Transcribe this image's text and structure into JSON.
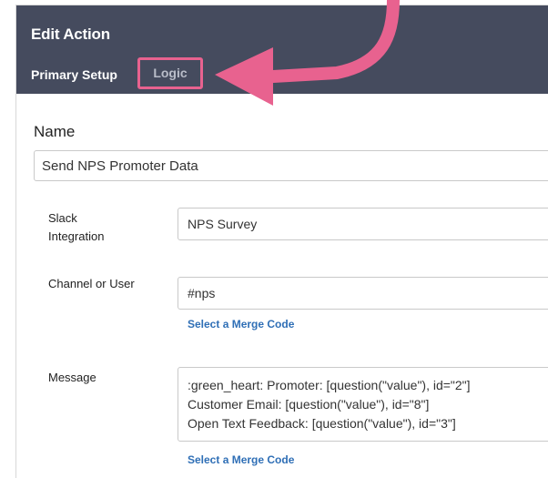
{
  "header": {
    "title": "Edit Action",
    "tabs": {
      "primary": "Primary Setup",
      "logic": "Logic"
    }
  },
  "form": {
    "name_label": "Name",
    "name_value": "Send NPS Promoter Data",
    "slack_label_1": "Slack",
    "slack_label_2": "Integration",
    "slack_value": "NPS Survey",
    "channel_label": "Channel or User",
    "channel_value": "#nps",
    "merge_code_link": "Select a Merge Code",
    "message_label": "Message",
    "message_lines": [
      ":green_heart: Promoter: [question(\"value\"), id=\"2\"]",
      "Customer Email: [question(\"value\"), id=\"8\"]",
      "Open Text Feedback: [question(\"value\"), id=\"3\"]"
    ]
  },
  "colors": {
    "header_bg": "#454b5e",
    "highlight": "#e8628f",
    "link": "#2f6fb6"
  }
}
